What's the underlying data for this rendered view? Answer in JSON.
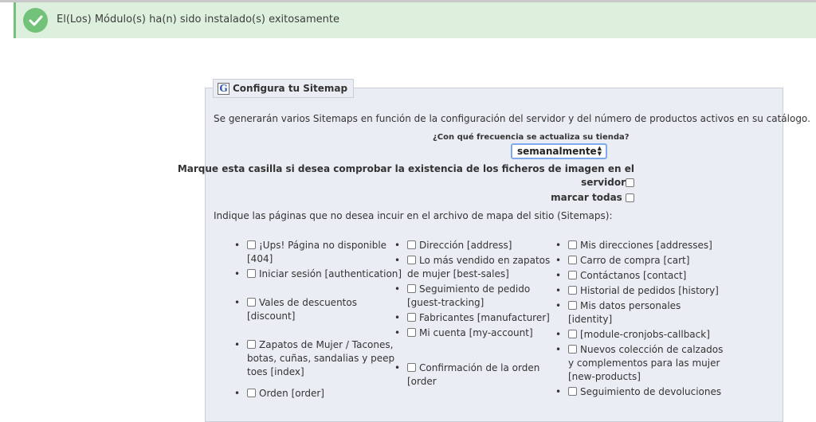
{
  "alert": {
    "message": "El(Los) Módulo(s) ha(n) sido instalado(s) exitosamente",
    "color": "#72c279",
    "icon": "check-icon"
  },
  "sitemap": {
    "title": "Configura tu Sitemap",
    "intro": "Se generarán varios Sitemaps en función de la configuración del servidor y del número de productos activos en su catálogo.",
    "frequency_label": "¿Con qué frecuencia se actualiza su tienda?",
    "frequency_value": "semanalmente",
    "check_images_line1": "Marque esta casilla si desea comprobar la existencia de los ficheros de imagen en el",
    "check_images_line2": "servidor",
    "check_all": "marcar todas",
    "exclude_label": "Indique las páginas que no desea incuir en el archivo de mapa del sitio (Sitemaps):",
    "pages_col1": [
      "¡Ups! Página no disponible [404]",
      "Iniciar sesión [authentication]",
      "Vales de descuentos [discount]",
      "Zapatos de Mujer / Tacones, botas, cuñas, sandalias y peep toes [index]",
      "Orden [order]"
    ],
    "pages_col2": [
      "Dirección [address]",
      "Lo más vendido en zapatos de mujer [best-sales]",
      "Seguimiento de pedido [guest-tracking]",
      "Fabricantes [manufacturer]",
      "Mi cuenta [my-account]",
      "Confirmación de la orden [order"
    ],
    "pages_col3": [
      "Mis direcciones [addresses]",
      "Carro de compra [cart]",
      "Contáctanos [contact]",
      "Historial de pedidos [history]",
      "Mis datos personales [identity]",
      "[module-cronjobs-callback]",
      "Nuevos colección de calzados y complementos para las mujer [new-products]",
      "Seguimiento de devoluciones"
    ]
  }
}
